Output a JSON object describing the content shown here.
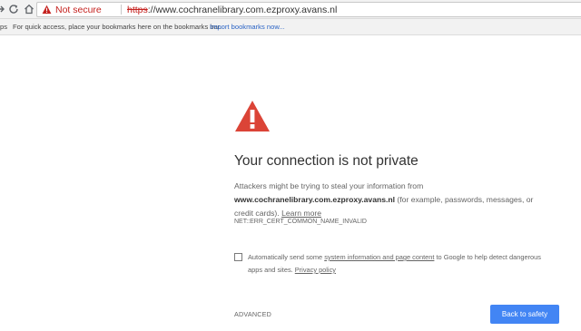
{
  "browser": {
    "security_label": "Not secure",
    "url_scheme": "https",
    "url_rest": "://www.cochranelibrary.com.ezproxy.avans.nl"
  },
  "bookmarks_bar": {
    "apps_label": "ps",
    "message": "For quick access, place your bookmarks here on the bookmarks bar.",
    "import_link": "Import bookmarks now..."
  },
  "interstitial": {
    "title": "Your connection is not private",
    "explanation_prefix": "Attackers might be trying to steal your information from",
    "host": "www.cochranelibrary.com.ezproxy.avans.nl",
    "explanation_suffix": "(for example, passwords, messages, or credit cards).",
    "learn_more": "Learn more",
    "error_code": "NET::ERR_CERT_COMMON_NAME_INVALID",
    "optin_prefix": "Automatically send some",
    "optin_link": "system information and page content",
    "optin_suffix": "to Google to help detect dangerous apps and sites.",
    "privacy_link": "Privacy policy",
    "advanced_label": "ADVANCED",
    "back_button_label": "Back to safety"
  },
  "colors": {
    "danger_red": "#db4437",
    "not_secure_red": "#c5221f",
    "button_blue": "#4285f4",
    "link_blue": "#2b64c5"
  }
}
